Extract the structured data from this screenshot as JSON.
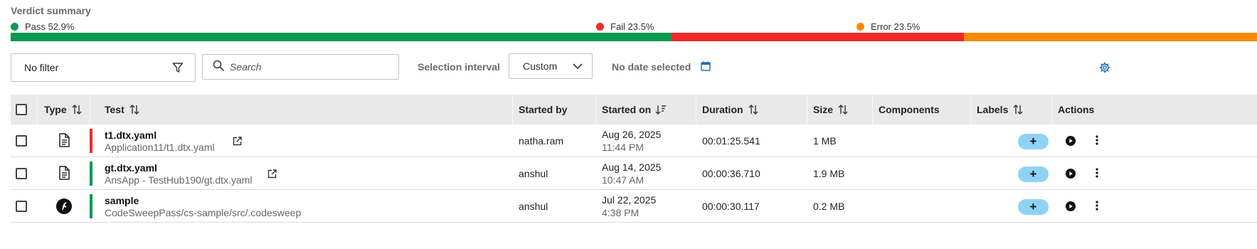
{
  "verdict": {
    "title": "Verdict summary",
    "items": [
      {
        "label": "Pass 52.9%",
        "value": 52.9,
        "color": "#0a9a52"
      },
      {
        "label": "Fail 23.5%",
        "value": 23.5,
        "color": "#ee2a2a"
      },
      {
        "label": "Error 23.5%",
        "value": 23.5,
        "color": "#f58b05"
      }
    ]
  },
  "toolbar": {
    "filter_label": "No filter",
    "search_placeholder": "Search",
    "selection_interval_label": "Selection interval",
    "interval_value": "Custom",
    "date_label": "No date selected"
  },
  "table": {
    "headers": {
      "type": "Type",
      "test": "Test",
      "started_by": "Started by",
      "started_on": "Started on",
      "duration": "Duration",
      "size": "Size",
      "components": "Components",
      "labels": "Labels",
      "actions": "Actions"
    },
    "rows": [
      {
        "type_icon": "document-icon",
        "status": "fail",
        "status_color": "#ee2a2a",
        "name": "t1.dtx.yaml",
        "path": "Application11/t1.dtx.yaml",
        "has_link": true,
        "started_by": "natha.ram",
        "date": "Aug 26, 2025",
        "time": "11:44 PM",
        "duration": "00:01:25.541",
        "size": "1 MB",
        "components": "",
        "label_button": "+"
      },
      {
        "type_icon": "document-icon",
        "status": "pass",
        "status_color": "#0a9a52",
        "name": "gt.dtx.yaml",
        "path": "AnsApp - TestHub190/gt.dtx.yaml",
        "has_link": true,
        "started_by": "anshul",
        "date": "Aug 14, 2025",
        "time": "10:47 AM",
        "duration": "00:00:36.710",
        "size": "1.9 MB",
        "components": "",
        "label_button": "+"
      },
      {
        "type_icon": "codesweep-icon",
        "status": "pass",
        "status_color": "#0a9a52",
        "name": "sample",
        "path": "CodeSweepPass/cs-sample/src/.codesweep",
        "has_link": false,
        "started_by": "anshul",
        "date": "Jul 22, 2025",
        "time": "4:38 PM",
        "duration": "00:00:30.117",
        "size": "0.2 MB",
        "components": "",
        "label_button": "+"
      }
    ]
  }
}
